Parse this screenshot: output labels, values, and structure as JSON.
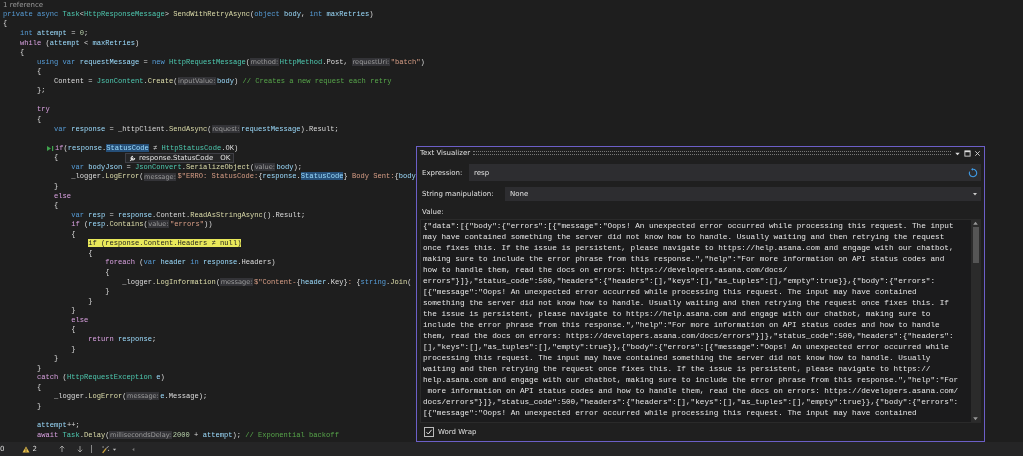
{
  "editor": {
    "lines": [
      {
        "kind": "codelens",
        "text": "1 reference"
      },
      {
        "kind": "code",
        "tokens": [
          {
            "kind": "kw",
            "text": "private async "
          },
          {
            "kind": "type",
            "text": "Task"
          },
          {
            "kind": "plain",
            "text": "<"
          },
          {
            "kind": "type",
            "text": "HttpResponseMessage"
          },
          {
            "kind": "plain",
            "text": "> "
          },
          {
            "kind": "method",
            "text": "SendWithRetryAsync"
          },
          {
            "kind": "plain",
            "text": "("
          },
          {
            "kind": "kw",
            "text": "object "
          },
          {
            "kind": "local",
            "text": "body"
          },
          {
            "kind": "plain",
            "text": ", "
          },
          {
            "kind": "kw",
            "text": "int "
          },
          {
            "kind": "local",
            "text": "maxRetries"
          },
          {
            "kind": "plain",
            "text": ")"
          }
        ]
      },
      {
        "kind": "code",
        "tokens": [
          {
            "kind": "plain",
            "text": "{"
          }
        ]
      },
      {
        "kind": "code",
        "tokens": [
          {
            "kind": "kw",
            "text": "    int "
          },
          {
            "kind": "local",
            "text": "attempt"
          },
          {
            "kind": "plain",
            "text": " = "
          },
          {
            "kind": "num",
            "text": "0"
          },
          {
            "kind": "plain",
            "text": ";"
          }
        ]
      },
      {
        "kind": "code",
        "tokens": [
          {
            "kind": "ctl",
            "text": "    while"
          },
          {
            "kind": "plain",
            "text": " ("
          },
          {
            "kind": "local",
            "text": "attempt"
          },
          {
            "kind": "plain",
            "text": " < "
          },
          {
            "kind": "local",
            "text": "maxRetries"
          },
          {
            "kind": "plain",
            "text": ")"
          }
        ]
      },
      {
        "kind": "code",
        "tokens": [
          {
            "kind": "plain",
            "text": "    {"
          }
        ]
      },
      {
        "kind": "code",
        "tokens": [
          {
            "kind": "kw",
            "text": "        using var "
          },
          {
            "kind": "local",
            "text": "requestMessage"
          },
          {
            "kind": "plain",
            "text": " = "
          },
          {
            "kind": "kw",
            "text": "new "
          },
          {
            "kind": "type",
            "text": "HttpRequestMessage"
          },
          {
            "kind": "plain",
            "text": "("
          },
          {
            "kind": "hint",
            "text": "method:"
          },
          {
            "kind": "type",
            "text": "HttpMethod"
          },
          {
            "kind": "plain",
            "text": ".Post, "
          },
          {
            "kind": "hint",
            "text": "requestUri:"
          },
          {
            "kind": "str",
            "text": "\"batch\""
          },
          {
            "kind": "plain",
            "text": ")"
          }
        ]
      },
      {
        "kind": "code",
        "tokens": [
          {
            "kind": "plain",
            "text": "        {"
          }
        ]
      },
      {
        "kind": "code",
        "tokens": [
          {
            "kind": "plain",
            "text": "            Content = "
          },
          {
            "kind": "type",
            "text": "JsonContent"
          },
          {
            "kind": "plain",
            "text": "."
          },
          {
            "kind": "method",
            "text": "Create"
          },
          {
            "kind": "plain",
            "text": "("
          },
          {
            "kind": "hint",
            "text": "inputValue:"
          },
          {
            "kind": "local",
            "text": "body"
          },
          {
            "kind": "plain",
            "text": ") "
          },
          {
            "kind": "cmt",
            "text": "// Creates a new request each retry"
          }
        ]
      },
      {
        "kind": "code",
        "tokens": [
          {
            "kind": "plain",
            "text": "        };"
          }
        ]
      },
      {
        "kind": "blank"
      },
      {
        "kind": "code",
        "tokens": [
          {
            "kind": "ctl",
            "text": "        try"
          }
        ]
      },
      {
        "kind": "code",
        "tokens": [
          {
            "kind": "plain",
            "text": "        {"
          }
        ]
      },
      {
        "kind": "code",
        "tokens": [
          {
            "kind": "kw",
            "text": "            var "
          },
          {
            "kind": "local",
            "text": "response"
          },
          {
            "kind": "plain",
            "text": " = _httpClient."
          },
          {
            "kind": "method",
            "text": "SendAsync"
          },
          {
            "kind": "plain",
            "text": "("
          },
          {
            "kind": "hint",
            "text": "request:"
          },
          {
            "kind": "local",
            "text": "requestMessage"
          },
          {
            "kind": "plain",
            "text": ").Result;"
          }
        ]
      },
      {
        "kind": "blank"
      },
      {
        "kind": "code",
        "tokens": [
          {
            "kind": "run-to-click"
          },
          {
            "kind": "ctl",
            "text": "          if"
          },
          {
            "kind": "plain",
            "text": "("
          },
          {
            "kind": "local",
            "text": "response"
          },
          {
            "kind": "plain",
            "text": "."
          },
          {
            "kind": "ref",
            "text": "StatusCode"
          },
          {
            "kind": "plain",
            "text": " ≠ "
          },
          {
            "kind": "type",
            "text": "HttpStatusCode"
          },
          {
            "kind": "plain",
            "text": ".OK)"
          }
        ]
      },
      {
        "kind": "code",
        "tokens": [
          {
            "kind": "plain",
            "text": "            {"
          }
        ]
      },
      {
        "kind": "code",
        "tokens": [
          {
            "kind": "kw",
            "text": "                var "
          },
          {
            "kind": "local",
            "text": "bodyJson"
          },
          {
            "kind": "plain",
            "text": " = "
          },
          {
            "kind": "type",
            "text": "JsonConvert"
          },
          {
            "kind": "plain",
            "text": "."
          },
          {
            "kind": "method",
            "text": "SerializeObject"
          },
          {
            "kind": "plain",
            "text": "("
          },
          {
            "kind": "hint",
            "text": "value:"
          },
          {
            "kind": "local",
            "text": "body"
          },
          {
            "kind": "plain",
            "text": ");"
          }
        ]
      },
      {
        "kind": "code",
        "tokens": [
          {
            "kind": "plain",
            "text": "                _logger."
          },
          {
            "kind": "method",
            "text": "LogError"
          },
          {
            "kind": "plain",
            "text": "("
          },
          {
            "kind": "hint",
            "text": "message:"
          },
          {
            "kind": "str",
            "text": "$\"ERRO: StatusCode:"
          },
          {
            "kind": "plain",
            "text": "{"
          },
          {
            "kind": "local",
            "text": "response"
          },
          {
            "kind": "plain",
            "text": "."
          },
          {
            "kind": "ref",
            "text": "StatusCode"
          },
          {
            "kind": "plain",
            "text": "}"
          },
          {
            "kind": "str",
            "text": " Body Sent:"
          },
          {
            "kind": "plain",
            "text": "{"
          },
          {
            "kind": "local",
            "text": "body"
          }
        ]
      },
      {
        "kind": "code",
        "tokens": [
          {
            "kind": "plain",
            "text": "            }"
          }
        ]
      },
      {
        "kind": "code",
        "tokens": [
          {
            "kind": "ctl",
            "text": "            else"
          }
        ]
      },
      {
        "kind": "code",
        "tokens": [
          {
            "kind": "plain",
            "text": "            {"
          }
        ]
      },
      {
        "kind": "code",
        "tokens": [
          {
            "kind": "kw",
            "text": "                var "
          },
          {
            "kind": "local",
            "text": "resp"
          },
          {
            "kind": "plain",
            "text": " = "
          },
          {
            "kind": "local",
            "text": "response"
          },
          {
            "kind": "plain",
            "text": ".Content."
          },
          {
            "kind": "method",
            "text": "ReadAsStringAsync"
          },
          {
            "kind": "plain",
            "text": "().Result;"
          }
        ]
      },
      {
        "kind": "code",
        "tokens": [
          {
            "kind": "ctl",
            "text": "                if"
          },
          {
            "kind": "plain",
            "text": " ("
          },
          {
            "kind": "local",
            "text": "resp"
          },
          {
            "kind": "plain",
            "text": "."
          },
          {
            "kind": "method",
            "text": "Contains"
          },
          {
            "kind": "plain",
            "text": "("
          },
          {
            "kind": "hint",
            "text": "value:"
          },
          {
            "kind": "str",
            "text": "\"errors\""
          },
          {
            "kind": "plain",
            "text": "))"
          }
        ]
      },
      {
        "kind": "code",
        "tokens": [
          {
            "kind": "plain",
            "text": "                {"
          }
        ]
      },
      {
        "kind": "code",
        "tokens": [
          {
            "kind": "current",
            "text": "                    if (response.Content.Headers ≠ null)"
          }
        ]
      },
      {
        "kind": "code",
        "tokens": [
          {
            "kind": "plain",
            "text": "                    {"
          }
        ]
      },
      {
        "kind": "code",
        "tokens": [
          {
            "kind": "ctl",
            "text": "                        foreach"
          },
          {
            "kind": "plain",
            "text": " ("
          },
          {
            "kind": "kw",
            "text": "var "
          },
          {
            "kind": "local",
            "text": "header"
          },
          {
            "kind": "kw",
            "text": " in "
          },
          {
            "kind": "local",
            "text": "response"
          },
          {
            "kind": "plain",
            "text": ".Headers)"
          }
        ]
      },
      {
        "kind": "code",
        "tokens": [
          {
            "kind": "plain",
            "text": "                        {"
          }
        ]
      },
      {
        "kind": "code",
        "tokens": [
          {
            "kind": "plain",
            "text": "                            _logger."
          },
          {
            "kind": "method",
            "text": "LogInformation"
          },
          {
            "kind": "plain",
            "text": "("
          },
          {
            "kind": "hint",
            "text": "message:"
          },
          {
            "kind": "str",
            "text": "$\"Content-"
          },
          {
            "kind": "plain",
            "text": "{"
          },
          {
            "kind": "local",
            "text": "header"
          },
          {
            "kind": "plain",
            "text": ".Key}"
          },
          {
            "kind": "str",
            "text": ": "
          },
          {
            "kind": "plain",
            "text": "{"
          },
          {
            "kind": "kw",
            "text": "string"
          },
          {
            "kind": "plain",
            "text": "."
          },
          {
            "kind": "method",
            "text": "Join"
          },
          {
            "kind": "plain",
            "text": "("
          }
        ]
      },
      {
        "kind": "code",
        "tokens": [
          {
            "kind": "plain",
            "text": "                        }"
          }
        ]
      },
      {
        "kind": "code",
        "tokens": [
          {
            "kind": "plain",
            "text": "                    }"
          }
        ]
      },
      {
        "kind": "code",
        "tokens": [
          {
            "kind": "plain",
            "text": "                }"
          }
        ]
      },
      {
        "kind": "code",
        "tokens": [
          {
            "kind": "ctl",
            "text": "                else"
          }
        ]
      },
      {
        "kind": "code",
        "tokens": [
          {
            "kind": "plain",
            "text": "                {"
          }
        ]
      },
      {
        "kind": "code",
        "tokens": [
          {
            "kind": "ctl",
            "text": "                    return "
          },
          {
            "kind": "local",
            "text": "response"
          },
          {
            "kind": "plain",
            "text": ";"
          }
        ]
      },
      {
        "kind": "code",
        "tokens": [
          {
            "kind": "plain",
            "text": "                }"
          }
        ]
      },
      {
        "kind": "code",
        "tokens": [
          {
            "kind": "plain",
            "text": "            }"
          }
        ]
      },
      {
        "kind": "code",
        "tokens": [
          {
            "kind": "plain",
            "text": "        }"
          }
        ]
      },
      {
        "kind": "code",
        "tokens": [
          {
            "kind": "ctl",
            "text": "        catch"
          },
          {
            "kind": "plain",
            "text": " ("
          },
          {
            "kind": "type",
            "text": "HttpRequestException "
          },
          {
            "kind": "local",
            "text": "e"
          },
          {
            "kind": "plain",
            "text": ")"
          }
        ]
      },
      {
        "kind": "code",
        "tokens": [
          {
            "kind": "plain",
            "text": "        {"
          }
        ]
      },
      {
        "kind": "code",
        "tokens": [
          {
            "kind": "plain",
            "text": "            _logger."
          },
          {
            "kind": "method",
            "text": "LogError"
          },
          {
            "kind": "plain",
            "text": "("
          },
          {
            "kind": "hint",
            "text": "message:"
          },
          {
            "kind": "local",
            "text": "e"
          },
          {
            "kind": "plain",
            "text": ".Message);"
          }
        ]
      },
      {
        "kind": "code",
        "tokens": [
          {
            "kind": "plain",
            "text": "        }"
          }
        ]
      },
      {
        "kind": "blank"
      },
      {
        "kind": "code",
        "tokens": [
          {
            "kind": "local",
            "text": "        attempt"
          },
          {
            "kind": "plain",
            "text": "++;"
          }
        ]
      },
      {
        "kind": "code",
        "tokens": [
          {
            "kind": "ctl",
            "text": "        await "
          },
          {
            "kind": "type",
            "text": "Task"
          },
          {
            "kind": "plain",
            "text": "."
          },
          {
            "kind": "method",
            "text": "Delay"
          },
          {
            "kind": "plain",
            "text": "("
          },
          {
            "kind": "hint",
            "text": "millisecondsDelay:"
          },
          {
            "kind": "num",
            "text": "2000"
          },
          {
            "kind": "plain",
            "text": " + "
          },
          {
            "kind": "local",
            "text": "attempt"
          },
          {
            "kind": "plain",
            "text": "); "
          },
          {
            "kind": "cmt",
            "text": "// Exponential backoff"
          }
        ]
      }
    ]
  },
  "tooltip": {
    "expression": "response.StatusCode",
    "value": "OK"
  },
  "visualizer": {
    "title": "Text Visualizer",
    "expression_label": "Expression:",
    "expression": "resp",
    "manipulation_label": "String manipulation:",
    "manipulation": "None",
    "value_label": "Value:",
    "value_lines": [
      "{\"data\":[{\"body\":{\"errors\":[{\"message\":\"Oops! An unexpected error occurred while processing this request. The input",
      "may have contained something the server did not know how to handle. Usually waiting and then retrying the request",
      "once fixes this. If the issue is persistent, please navigate to https://help.asana.com and engage with our chatbot,",
      "making sure to include the error phrase from this response.\",\"help\":\"For more information on API status codes and",
      "how to handle them, read the docs on errors: https://developers.asana.com/docs/",
      "errors\"}]},\"status_code\":500,\"headers\":{\"headers\":[],\"keys\":[],\"as_tuples\":[],\"empty\":true}},{\"body\":{\"errors\":",
      "[{\"message\":\"Oops! An unexpected error occurred while processing this request. The input may have contained",
      "something the server did not know how to handle. Usually waiting and then retrying the request once fixes this. If",
      "the issue is persistent, please navigate to https://help.asana.com and engage with our chatbot, making sure to",
      "include the error phrase from this response.\",\"help\":\"For more information on API status codes and how to handle",
      "them, read the docs on errors: https://developers.asana.com/docs/errors\"}]},\"status_code\":500,\"headers\":{\"headers\":",
      "[],\"keys\":[],\"as_tuples\":[],\"empty\":true}},{\"body\":{\"errors\":[{\"message\":\"Oops! An unexpected error occurred while",
      "processing this request. The input may have contained something the server did not know how to handle. Usually",
      "waiting and then retrying the request once fixes this. If the issue is persistent, please navigate to https://",
      "help.asana.com and engage with our chatbot, making sure to include the error phrase from this response.\",\"help\":\"For",
      " more information on API status codes and how to handle them, read the docs on errors: https://developers.asana.com/",
      "docs/errors\"}]},\"status_code\":500,\"headers\":{\"headers\":[],\"keys\":[],\"as_tuples\":[],\"empty\":true}},{\"body\":{\"errors\":",
      "[{\"message\":\"Oops! An unexpected error occurred while processing this request. The input may have contained"
    ],
    "word_wrap": {
      "label": "Word Wrap",
      "checked": true
    }
  },
  "status_bar": {
    "errors": "0",
    "warnings": "2"
  }
}
